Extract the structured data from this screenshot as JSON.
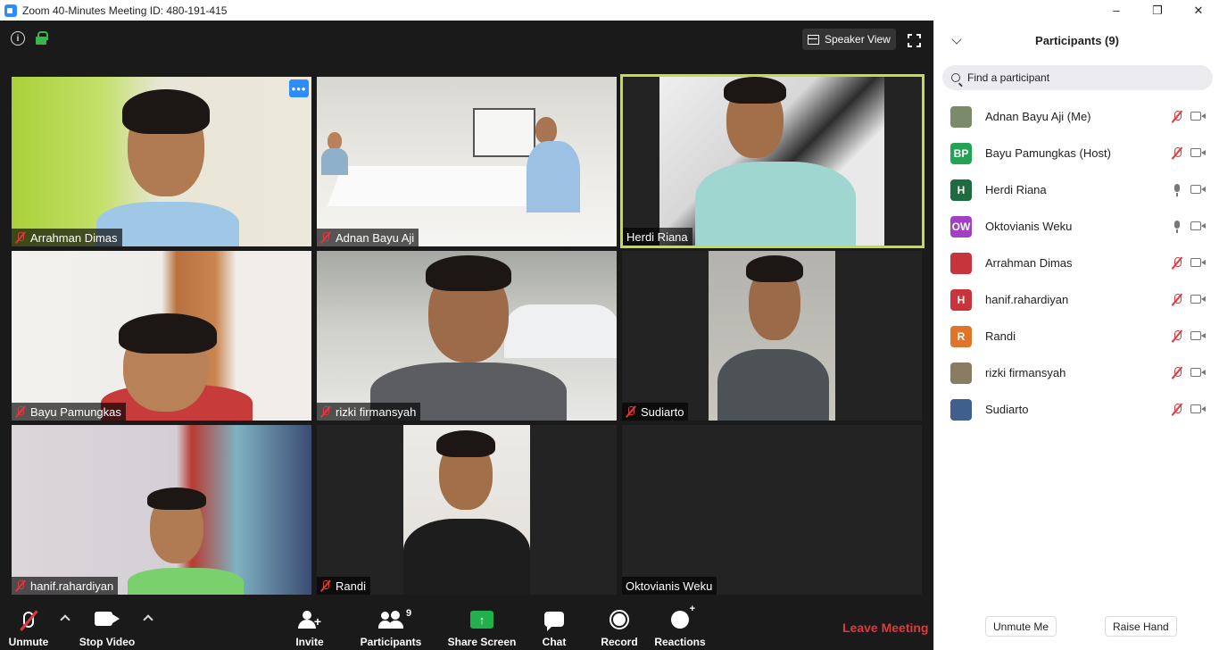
{
  "window": {
    "title": "Zoom 40-Minutes Meeting ID: 480-191-415",
    "controls": [
      "–",
      "❐",
      "✕"
    ]
  },
  "view": {
    "speaker_view_label": "Speaker View"
  },
  "tiles": [
    {
      "name": "Arrahman Dimas",
      "muted": true
    },
    {
      "name": "Adnan Bayu Aji",
      "muted": true
    },
    {
      "name": "Herdi Riana",
      "muted": false,
      "active_speaker": true
    },
    {
      "name": "Bayu Pamungkas",
      "muted": true
    },
    {
      "name": "rizki firmansyah",
      "muted": true
    },
    {
      "name": "Sudiarto",
      "muted": true
    },
    {
      "name": "hanif.rahardiyan",
      "muted": true
    },
    {
      "name": "Randi",
      "muted": true
    },
    {
      "name": "Oktovianis Weku",
      "muted": false
    }
  ],
  "toolbar": {
    "unmute": "Unmute",
    "stop_video": "Stop Video",
    "invite": "Invite",
    "participants": "Participants",
    "participants_count": "9",
    "share_screen": "Share Screen",
    "chat": "Chat",
    "record": "Record",
    "reactions": "Reactions",
    "leave": "Leave Meeting",
    "share_arrow": "↑"
  },
  "panel": {
    "title": "Participants (9)",
    "search_placeholder": "Find a participant",
    "participants": [
      {
        "name": "Adnan Bayu Aji (Me)",
        "initials": "",
        "color": "#7b8a6a",
        "mic": "muted"
      },
      {
        "name": "Bayu Pamungkas (Host)",
        "initials": "BP",
        "color": "#23a455",
        "mic": "muted"
      },
      {
        "name": "Herdi Riana",
        "initials": "H",
        "color": "#1f6b3f",
        "mic": "on"
      },
      {
        "name": "Oktovianis Weku",
        "initials": "OW",
        "color": "#a23fc4",
        "mic": "on"
      },
      {
        "name": "Arrahman Dimas",
        "initials": "",
        "color": "#c8343c",
        "mic": "muted"
      },
      {
        "name": "hanif.rahardiyan",
        "initials": "H",
        "color": "#c8343c",
        "mic": "muted"
      },
      {
        "name": "Randi",
        "initials": "R",
        "color": "#e0752a",
        "mic": "muted"
      },
      {
        "name": "rizki firmansyah",
        "initials": "",
        "color": "#8a7b63",
        "mic": "muted"
      },
      {
        "name": "Sudiarto",
        "initials": "",
        "color": "#3f5f8f",
        "mic": "muted"
      }
    ],
    "unmute_me": "Unmute Me",
    "raise_hand": "Raise Hand"
  }
}
